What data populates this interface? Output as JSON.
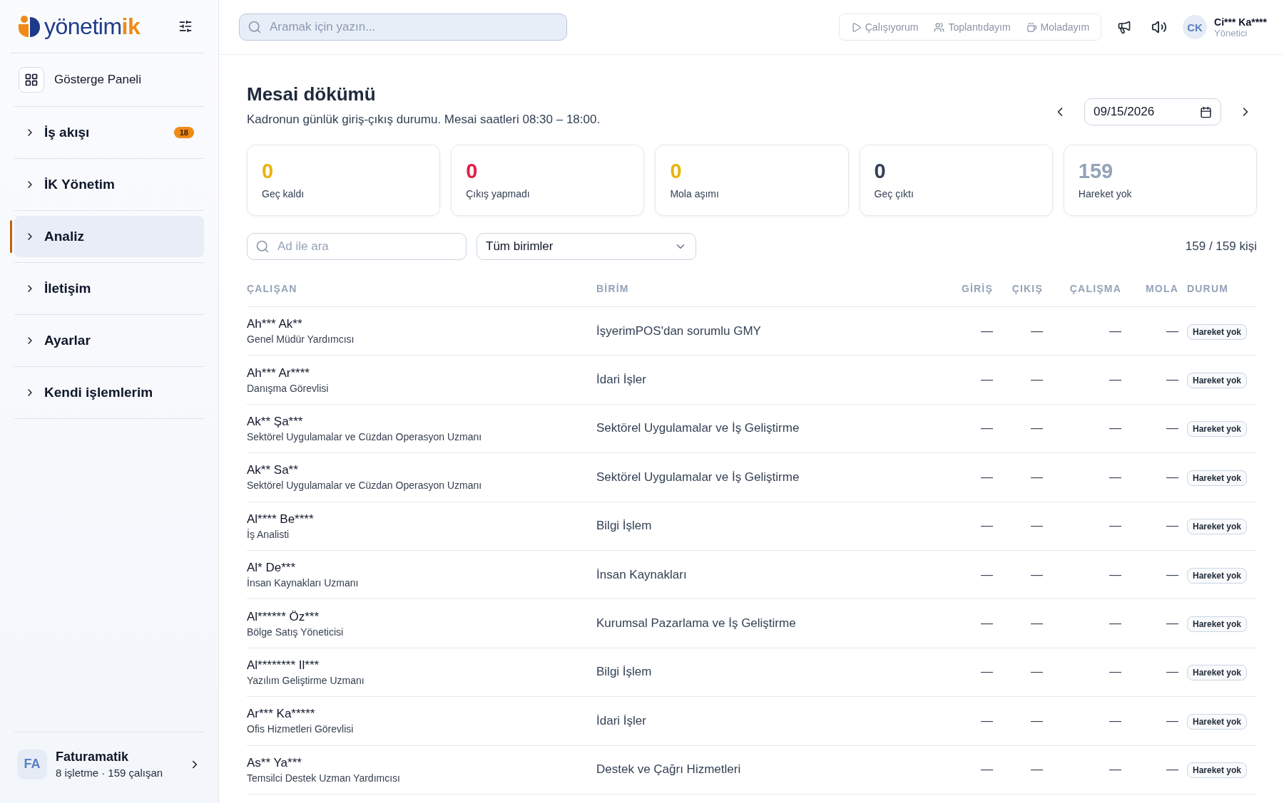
{
  "logo": {
    "text": "yönetim",
    "accent": "ik"
  },
  "sidebar": {
    "items": [
      {
        "kind": "link",
        "label": "Gösterge Paneli",
        "selected": false
      },
      {
        "kind": "group",
        "label": "İş akışı",
        "badge": "18",
        "selected": false
      },
      {
        "kind": "group",
        "label": "İK Yönetim",
        "selected": false
      },
      {
        "kind": "group",
        "label": "Analiz",
        "selected": true
      },
      {
        "kind": "group",
        "label": "İletişim",
        "selected": false
      },
      {
        "kind": "group",
        "label": "Ayarlar",
        "selected": false
      },
      {
        "kind": "group",
        "label": "Kendi işlemlerim",
        "selected": false
      }
    ],
    "company": {
      "initials": "FA",
      "name": "Faturamatik",
      "meta": "8 işletme · 159 çalışan"
    }
  },
  "topbar": {
    "search": {
      "placeholder": "Aramak için yazın..."
    },
    "status_buttons": [
      {
        "kind": "working",
        "label": "Çalışıyorum"
      },
      {
        "kind": "meeting",
        "label": "Toplantıdayım"
      },
      {
        "kind": "break",
        "label": "Moladayım"
      }
    ],
    "user": {
      "initials": "CK",
      "name": "Ci*** Ka****",
      "role": "Yönetici"
    }
  },
  "page": {
    "title": "Mesai dökümü",
    "subtitle": "Kadronun günlük giriş-çıkış durumu. Mesai saatleri 08:30 – 18:00.",
    "date": "09/15/2026"
  },
  "stats": [
    {
      "value": "0",
      "label": "Geç kaldı",
      "color": "#eab308"
    },
    {
      "value": "0",
      "label": "Çıkış yapmadı",
      "color": "#e11d48"
    },
    {
      "value": "0",
      "label": "Mola aşımı",
      "color": "#eab308"
    },
    {
      "value": "0",
      "label": "Geç çıktı",
      "color": "#334155"
    },
    {
      "value": "159",
      "label": "Hareket yok",
      "color": "#94a3b8"
    }
  ],
  "filters": {
    "search": {
      "placeholder": "Ad ile ara"
    },
    "unit": "Tüm birimler",
    "count": "159 / 159 kişi"
  },
  "table": {
    "columns": [
      "ÇALIŞAN",
      "BİRİM",
      "GİRİŞ",
      "ÇIKIŞ",
      "ÇALIŞMA",
      "MOLA",
      "DURUM"
    ],
    "rows": [
      {
        "name": "Ah*** Ak**",
        "title": "Genel Müdür Yardımcısı",
        "unit": "İşyerimPOS'dan sorumlu GMY",
        "in": "—",
        "out": "—",
        "work": "—",
        "break": "—",
        "status": "Hareket yok"
      },
      {
        "name": "Ah*** Ar****",
        "title": "Danışma Görevlisi",
        "unit": "İdari İşler",
        "in": "—",
        "out": "—",
        "work": "—",
        "break": "—",
        "status": "Hareket yok"
      },
      {
        "name": "Ak** Şa***",
        "title": "Sektörel Uygulamalar ve Cüzdan Operasyon Uzmanı",
        "unit": "Sektörel Uygulamalar ve İş Geliştirme",
        "in": "—",
        "out": "—",
        "work": "—",
        "break": "—",
        "status": "Hareket yok"
      },
      {
        "name": "Ak** Sa**",
        "title": "Sektörel Uygulamalar ve Cüzdan Operasyon Uzmanı",
        "unit": "Sektörel Uygulamalar ve İş Geliştirme",
        "in": "—",
        "out": "—",
        "work": "—",
        "break": "—",
        "status": "Hareket yok"
      },
      {
        "name": "Al**** Be****",
        "title": "İş Analisti",
        "unit": "Bilgi İşlem",
        "in": "—",
        "out": "—",
        "work": "—",
        "break": "—",
        "status": "Hareket yok"
      },
      {
        "name": "Al* De***",
        "title": "İnsan Kaynakları Uzmanı",
        "unit": "İnsan Kaynakları",
        "in": "—",
        "out": "—",
        "work": "—",
        "break": "—",
        "status": "Hareket yok"
      },
      {
        "name": "Al****** Öz***",
        "title": "Bölge Satış Yöneticisi",
        "unit": "Kurumsal Pazarlama ve İş Geliştirme",
        "in": "—",
        "out": "—",
        "work": "—",
        "break": "—",
        "status": "Hareket yok"
      },
      {
        "name": "Al******** Il***",
        "title": "Yazılım Geliştirme Uzmanı",
        "unit": "Bilgi İşlem",
        "in": "—",
        "out": "—",
        "work": "—",
        "break": "—",
        "status": "Hareket yok"
      },
      {
        "name": "Ar*** Ka*****",
        "title": "Ofis Hizmetleri Görevlisi",
        "unit": "İdari İşler",
        "in": "—",
        "out": "—",
        "work": "—",
        "break": "—",
        "status": "Hareket yok"
      },
      {
        "name": "As** Ya***",
        "title": "Temsilci Destek Uzman Yardımcısı",
        "unit": "Destek ve Çağrı Hizmetleri",
        "in": "—",
        "out": "—",
        "work": "—",
        "break": "—",
        "status": "Hareket yok"
      }
    ]
  }
}
